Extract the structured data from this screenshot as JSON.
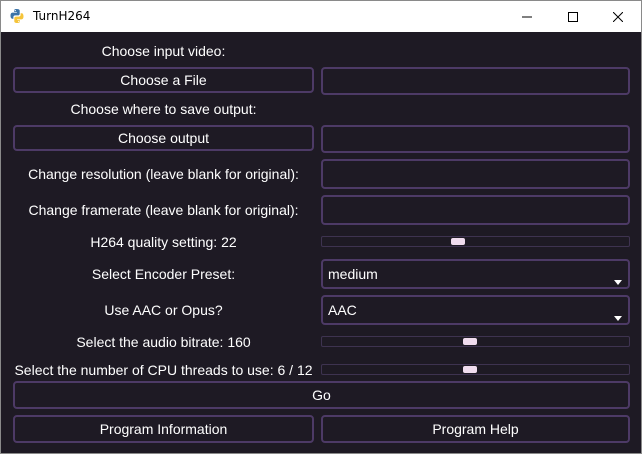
{
  "window": {
    "title": "TurnH264"
  },
  "labels": {
    "input_video": "Choose input video:",
    "output": "Choose where to save output:",
    "resolution": "Change resolution (leave blank for original):",
    "framerate": "Change framerate (leave blank for original):",
    "quality": "H264 quality setting: 22",
    "preset": "Select Encoder Preset:",
    "audio_codec": "Use AAC or Opus?",
    "bitrate": "Select the audio bitrate: 160",
    "threads": "Select the number of CPU threads to use: 6 / 12"
  },
  "buttons": {
    "choose_file": "Choose a File",
    "choose_output": "Choose output",
    "go": "Go",
    "program_information": "Program Information",
    "program_help": "Program Help"
  },
  "fields": {
    "input_path": "",
    "output_path": "",
    "resolution": "",
    "framerate": ""
  },
  "selects": {
    "preset": "medium",
    "audio_codec": "AAC"
  },
  "sliders": {
    "quality_value": 22,
    "quality_position": 0.44,
    "bitrate_value": 160,
    "bitrate_position": 0.48,
    "threads_value": 6,
    "threads_max": 12,
    "threads_position": 0.48
  },
  "colors": {
    "background": "#1e1a24",
    "border_accent": "#4d3a66",
    "slider_thumb": "#f0dcee",
    "text": "#ffffff"
  },
  "icons": [
    "python-icon",
    "minimize-icon",
    "maximize-icon",
    "close-icon",
    "chevron-down-icon"
  ]
}
